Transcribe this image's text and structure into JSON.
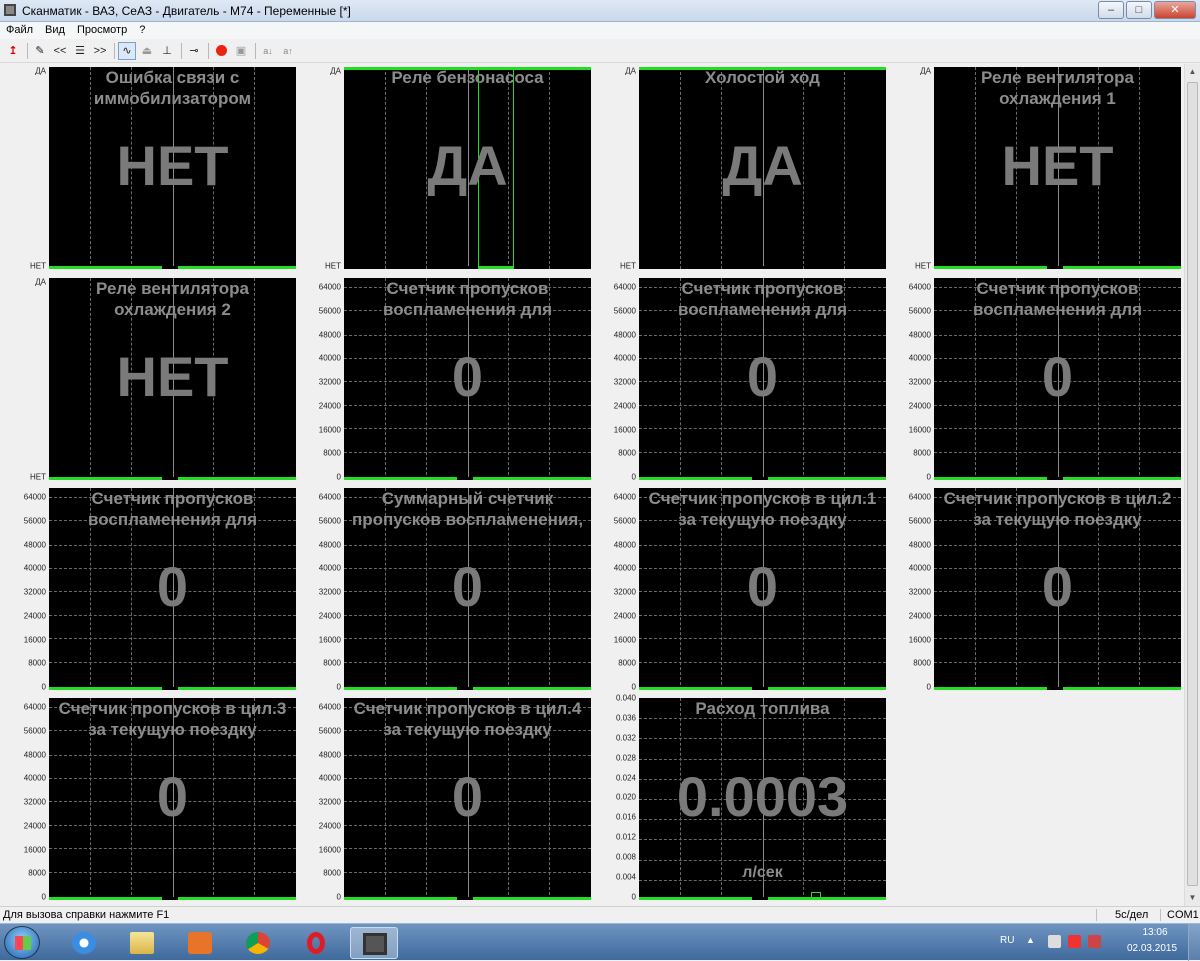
{
  "window": {
    "title": "Сканматик - ВАЗ, СеАЗ - Двигатель - М74 - Переменные [*]",
    "buttons": {
      "minimize": "–",
      "maximize": "□",
      "close": "✕"
    }
  },
  "menu": [
    "Файл",
    "Вид",
    "Просмотр",
    "?"
  ],
  "toolbar": {
    "icons": [
      "arrow-up-icon",
      "edit-icon",
      "rewind-icon",
      "list-icon",
      "forward-icon",
      "graph-icon",
      "upload-icon",
      "download-icon",
      "signal-icon",
      "record-icon",
      "save-icon",
      "sort-down-icon",
      "sort-up-icon"
    ],
    "labels": {
      "rewind": "<<",
      "list": "☰",
      "forward": ">>",
      "sort_down": "a↓",
      "sort_up": "a↑"
    }
  },
  "bool_axis": {
    "top": "ДА",
    "bottom": "НЕТ"
  },
  "count_axis": [
    "64000",
    "56000",
    "48000",
    "40000",
    "32000",
    "24000",
    "16000",
    "8000",
    "0"
  ],
  "fuel_axis": [
    "0.040",
    "0.036",
    "0.032",
    "0.028",
    "0.024",
    "0.020",
    "0.016",
    "0.012",
    "0.008",
    "0.004",
    "0"
  ],
  "panels": [
    {
      "title": "Ошибка связи с\nиммобилизатором",
      "value": "НЕТ",
      "state": "НЕТ"
    },
    {
      "title": "Реле бензонасоса",
      "value": "ДА",
      "state": "ДА"
    },
    {
      "title": "Холостой ход",
      "value": "ДА",
      "state": "ДА"
    },
    {
      "title": "Реле вентилятора\nохлаждения 1",
      "value": "НЕТ",
      "state": "НЕТ"
    },
    {
      "title": "Реле вентилятора\nохлаждения 2",
      "value": "НЕТ",
      "state": "НЕТ"
    },
    {
      "title": "Счетчик пропусков\nвоспламенения для",
      "value": "0"
    },
    {
      "title": "Счетчик пропусков\nвоспламенения для",
      "value": "0"
    },
    {
      "title": "Счетчик пропусков\nвоспламенения для",
      "value": "0"
    },
    {
      "title": "Счетчик пропусков\nвоспламенения для",
      "value": "0"
    },
    {
      "title": "Суммарный счетчик\nпропусков воспламенения,",
      "value": "0"
    },
    {
      "title": "Счетчик пропусков в цил.1\nза текущую поездку",
      "value": "0"
    },
    {
      "title": "Счетчик пропусков в цил.2\nза текущую поездку",
      "value": "0"
    },
    {
      "title": "Счетчик пропусков в цил.3\nза текущую поездку",
      "value": "0"
    },
    {
      "title": "Счетчик пропусков в цил.4\nза текущую поездку",
      "value": "0"
    },
    {
      "title": "Расход топлива",
      "value": "0.0003",
      "unit": "л/сек"
    }
  ],
  "status": {
    "help": "Для вызова справки нажмите F1",
    "scale": "5с/дел",
    "port": "COM1"
  },
  "taskbar": {
    "apps": [
      "ie-icon",
      "explorer-icon",
      "media-icon",
      "chrome-icon",
      "opera-icon",
      "scanmatik-icon"
    ],
    "lang": "RU",
    "time": "13:06",
    "date": "02.03.2015"
  },
  "colors": {
    "trace": "#22dd22",
    "plot_bg": "#000000",
    "overlay_text": "#8c8c8c"
  }
}
